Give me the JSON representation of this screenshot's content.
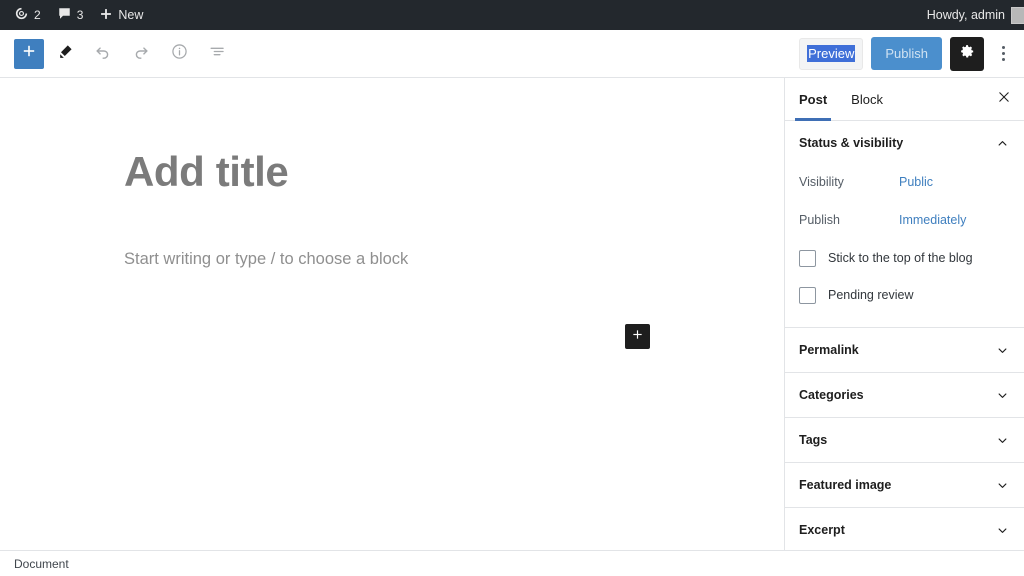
{
  "adminbar": {
    "updates_icon": "wordpress-updates-icon",
    "updates_count": "2",
    "comments_icon": "comment-bubble-icon",
    "comments_count": "3",
    "new_icon": "plus-icon",
    "new_label": "New",
    "howdy": "Howdy, admin",
    "avatar": "user-avatar"
  },
  "toolbar": {
    "add_block_icon": "plus-icon",
    "tools_icon": "pencil-icon",
    "undo_icon": "undo-arrow-icon",
    "redo_icon": "redo-arrow-icon",
    "details_icon": "info-circle-icon",
    "list_view_icon": "list-view-icon",
    "preview_label": "Preview",
    "publish_label": "Publish",
    "settings_icon": "gear-icon",
    "more_icon": "three-dots-vertical-icon",
    "accent_blue": "#3f7fbf",
    "publish_blue": "#4b8fcd",
    "selection_blue": "#3f6fd8"
  },
  "editor": {
    "title_placeholder": "Add title",
    "paragraph_placeholder": "Start writing or type / to choose a block",
    "block_inserter_icon": "plus-icon"
  },
  "sidebar": {
    "tabs": [
      {
        "label": "Post",
        "active": true
      },
      {
        "label": "Block",
        "active": false
      }
    ],
    "close_icon": "close-icon",
    "status_panel": {
      "title": "Status & visibility",
      "toggle_icon": "chevron-up-icon",
      "visibility_label": "Visibility",
      "visibility_value": "Public",
      "publish_label": "Publish",
      "publish_value": "Immediately",
      "sticky_label": "Stick to the top of the blog",
      "sticky_checked": false,
      "pending_label": "Pending review",
      "pending_checked": false
    },
    "panels": [
      {
        "title": "Permalink",
        "toggle_icon": "chevron-down-icon"
      },
      {
        "title": "Categories",
        "toggle_icon": "chevron-down-icon"
      },
      {
        "title": "Tags",
        "toggle_icon": "chevron-down-icon"
      },
      {
        "title": "Featured image",
        "toggle_icon": "chevron-down-icon"
      },
      {
        "title": "Excerpt",
        "toggle_icon": "chevron-down-icon"
      }
    ]
  },
  "statusbar": {
    "breadcrumb": "Document"
  }
}
